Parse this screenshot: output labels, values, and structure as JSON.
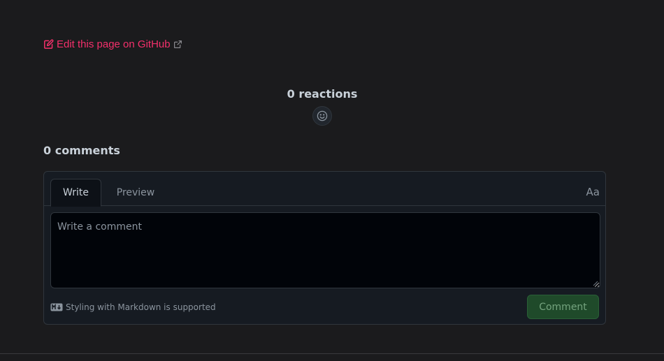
{
  "edit_link": {
    "label": "Edit this page on GitHub"
  },
  "reactions": {
    "title": "0 reactions"
  },
  "comments": {
    "title": "0 comments",
    "tabs": [
      {
        "label": "Write"
      },
      {
        "label": "Preview"
      }
    ],
    "font_toggle": "Aa",
    "input": {
      "placeholder": "Write a comment",
      "value": ""
    },
    "markdown_note": "Styling with Markdown is supported",
    "submit_label": "Comment"
  },
  "colors": {
    "link": "#f4306b",
    "background": "#1b1b1d",
    "submit_bg": "#1f4a2a"
  }
}
